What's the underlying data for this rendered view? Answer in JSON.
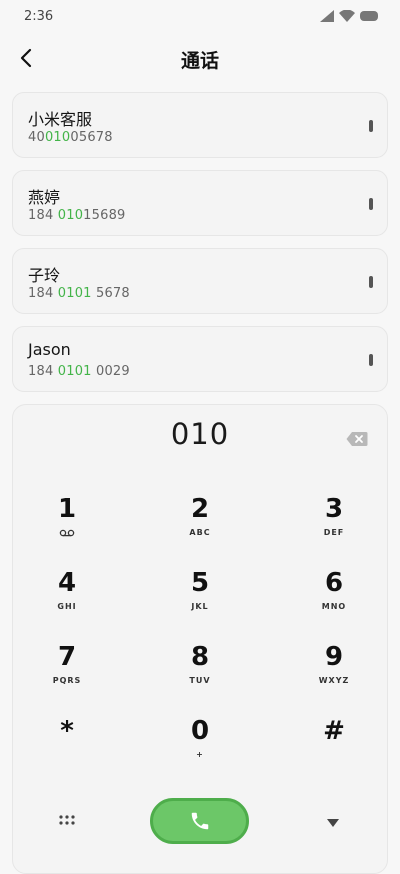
{
  "status": {
    "time": "2:36",
    "icons": [
      "signal-icon",
      "wifi-icon",
      "battery-icon"
    ]
  },
  "header": {
    "title": "通话",
    "back_icon": "chevron-left-icon"
  },
  "accent_color": "#43b449",
  "call_button_color": "#6cc768",
  "contacts": [
    {
      "name": "小米客服",
      "number_prefix": "40",
      "number_match": "010",
      "number_suffix": "05678"
    },
    {
      "name": "燕婷",
      "number_prefix": "184 ",
      "number_match": "010",
      "number_suffix": "15689"
    },
    {
      "name": "子玲",
      "number_prefix": "184 ",
      "number_match": "0101",
      "number_suffix": " 5678"
    },
    {
      "name": "Jason",
      "number_prefix": "184 ",
      "number_match": "0101",
      "number_suffix": " 0029"
    }
  ],
  "dialer": {
    "input": "010",
    "backspace_icon": "backspace-icon",
    "keys": [
      {
        "digit": "1",
        "letters": ""
      },
      {
        "digit": "2",
        "letters": "ABC"
      },
      {
        "digit": "3",
        "letters": "DEF"
      },
      {
        "digit": "4",
        "letters": "GHI"
      },
      {
        "digit": "5",
        "letters": "JKL"
      },
      {
        "digit": "6",
        "letters": "MNO"
      },
      {
        "digit": "7",
        "letters": "PQRS"
      },
      {
        "digit": "8",
        "letters": "TUV"
      },
      {
        "digit": "9",
        "letters": "WXYZ"
      },
      {
        "digit": "*",
        "letters": ""
      },
      {
        "digit": "0",
        "letters": "+"
      },
      {
        "digit": "#",
        "letters": ""
      }
    ]
  },
  "bottom_bar": {
    "left_icon": "grid-menu-icon",
    "center_icon": "phone-icon",
    "right_icon": "triangle-down-icon"
  }
}
